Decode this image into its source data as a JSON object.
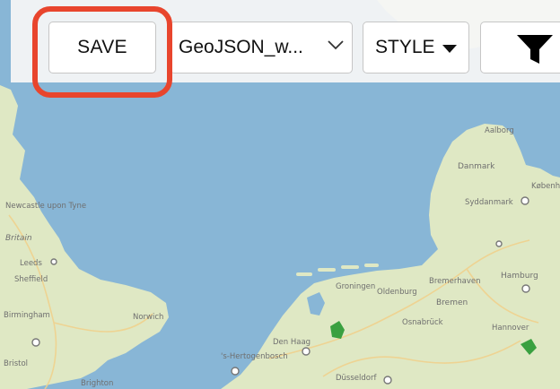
{
  "toolbar": {
    "save_label": "SAVE",
    "layer_select_value": "GeoJSON_w...",
    "style_label": "STYLE"
  },
  "icons": {
    "layer_select_chevron": "chevron-down-icon",
    "style_caret": "caret-down-icon",
    "filter": "filter-icon"
  },
  "colors": {
    "sea": "#88b6d6",
    "land": "#dfe8c4",
    "highlight": "#e8452d"
  },
  "map": {
    "labels": {
      "aalborg": "Aalborg",
      "danmark": "Danmark",
      "syddanmark": "Syddanmark",
      "kobenhavn": "København",
      "hamburg": "Hamburg",
      "bremerhaven": "Bremerhaven",
      "bremen": "Bremen",
      "groningen": "Groningen",
      "oldenburg": "Oldenburg",
      "osnabruck": "Osnabrück",
      "hannover": "Hannover",
      "newcastle": "Newcastle upon Tyne",
      "britain": "Britain",
      "leeds": "Leeds",
      "sheffield": "Sheffield",
      "birmingham": "Birmingham",
      "bristol": "Bristol",
      "norwich": "Norwich",
      "denhaag": "Den Haag",
      "hertogenbosch": "'s-Hertogenbosch",
      "dusseldorf": "Düsseldorf",
      "brighton": "Brighton"
    }
  }
}
